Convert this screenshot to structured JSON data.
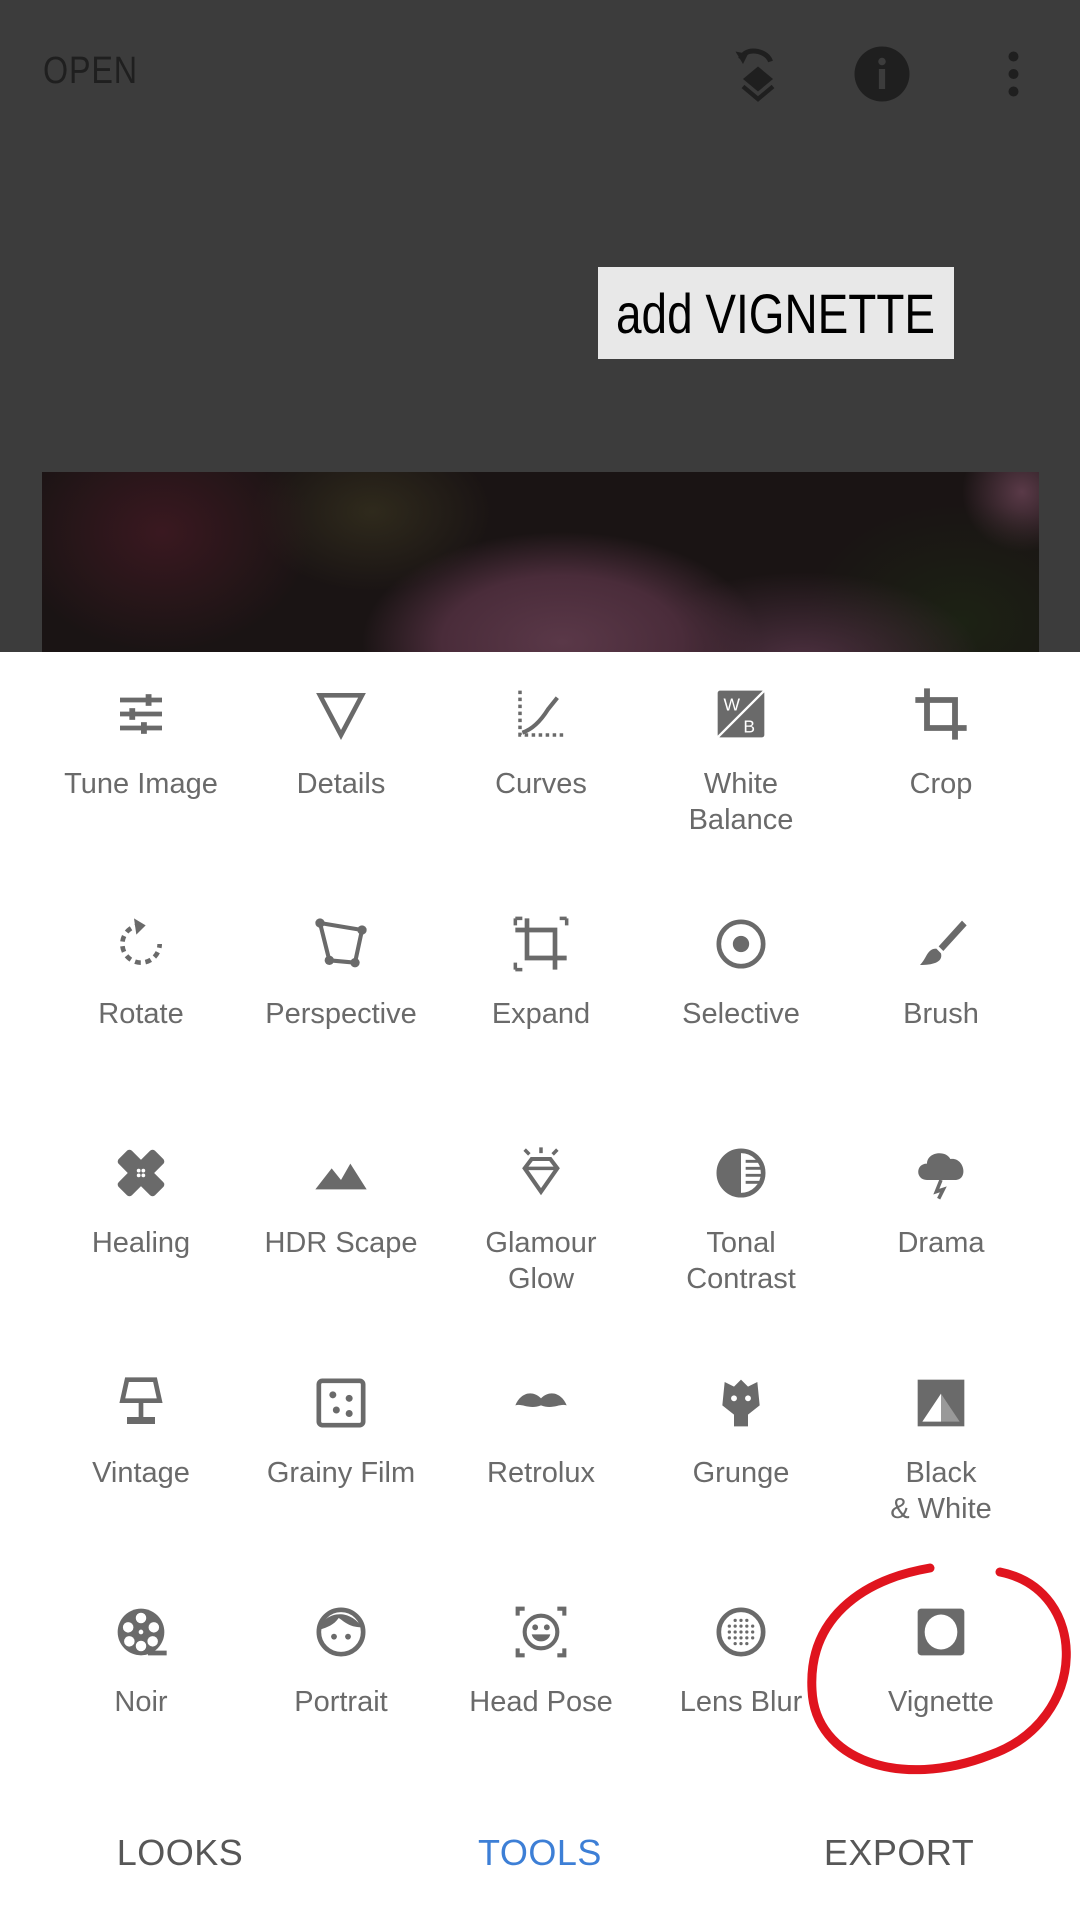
{
  "header": {
    "open_label": "OPEN",
    "icons": [
      "undo-layers-icon",
      "info-icon",
      "more-vert-icon"
    ]
  },
  "annotation": {
    "caption": "add VIGNETTE",
    "circle_color": "#e0141e",
    "circled_tool": "Vignette"
  },
  "tools": [
    {
      "label": "Tune Image",
      "icon": "tune"
    },
    {
      "label": "Details",
      "icon": "details"
    },
    {
      "label": "Curves",
      "icon": "curves"
    },
    {
      "label": "White\nBalance",
      "icon": "white-balance"
    },
    {
      "label": "Crop",
      "icon": "crop"
    },
    {
      "label": "Rotate",
      "icon": "rotate"
    },
    {
      "label": "Perspective",
      "icon": "perspective"
    },
    {
      "label": "Expand",
      "icon": "expand"
    },
    {
      "label": "Selective",
      "icon": "selective"
    },
    {
      "label": "Brush",
      "icon": "brush"
    },
    {
      "label": "Healing",
      "icon": "healing"
    },
    {
      "label": "HDR Scape",
      "icon": "hdr"
    },
    {
      "label": "Glamour\nGlow",
      "icon": "glamour"
    },
    {
      "label": "Tonal\nContrast",
      "icon": "tonal"
    },
    {
      "label": "Drama",
      "icon": "drama"
    },
    {
      "label": "Vintage",
      "icon": "vintage"
    },
    {
      "label": "Grainy Film",
      "icon": "grainy"
    },
    {
      "label": "Retrolux",
      "icon": "retrolux"
    },
    {
      "label": "Grunge",
      "icon": "grunge"
    },
    {
      "label": "Black\n& White",
      "icon": "bw"
    },
    {
      "label": "Noir",
      "icon": "noir"
    },
    {
      "label": "Portrait",
      "icon": "portrait"
    },
    {
      "label": "Head Pose",
      "icon": "headpose"
    },
    {
      "label": "Lens Blur",
      "icon": "lensblur"
    },
    {
      "label": "Vignette",
      "icon": "vignette"
    }
  ],
  "bottom_nav": {
    "items": [
      {
        "label": "LOOKS"
      },
      {
        "label": "TOOLS",
        "active": true
      },
      {
        "label": "EXPORT"
      }
    ],
    "active_color": "#3d7fd6"
  }
}
